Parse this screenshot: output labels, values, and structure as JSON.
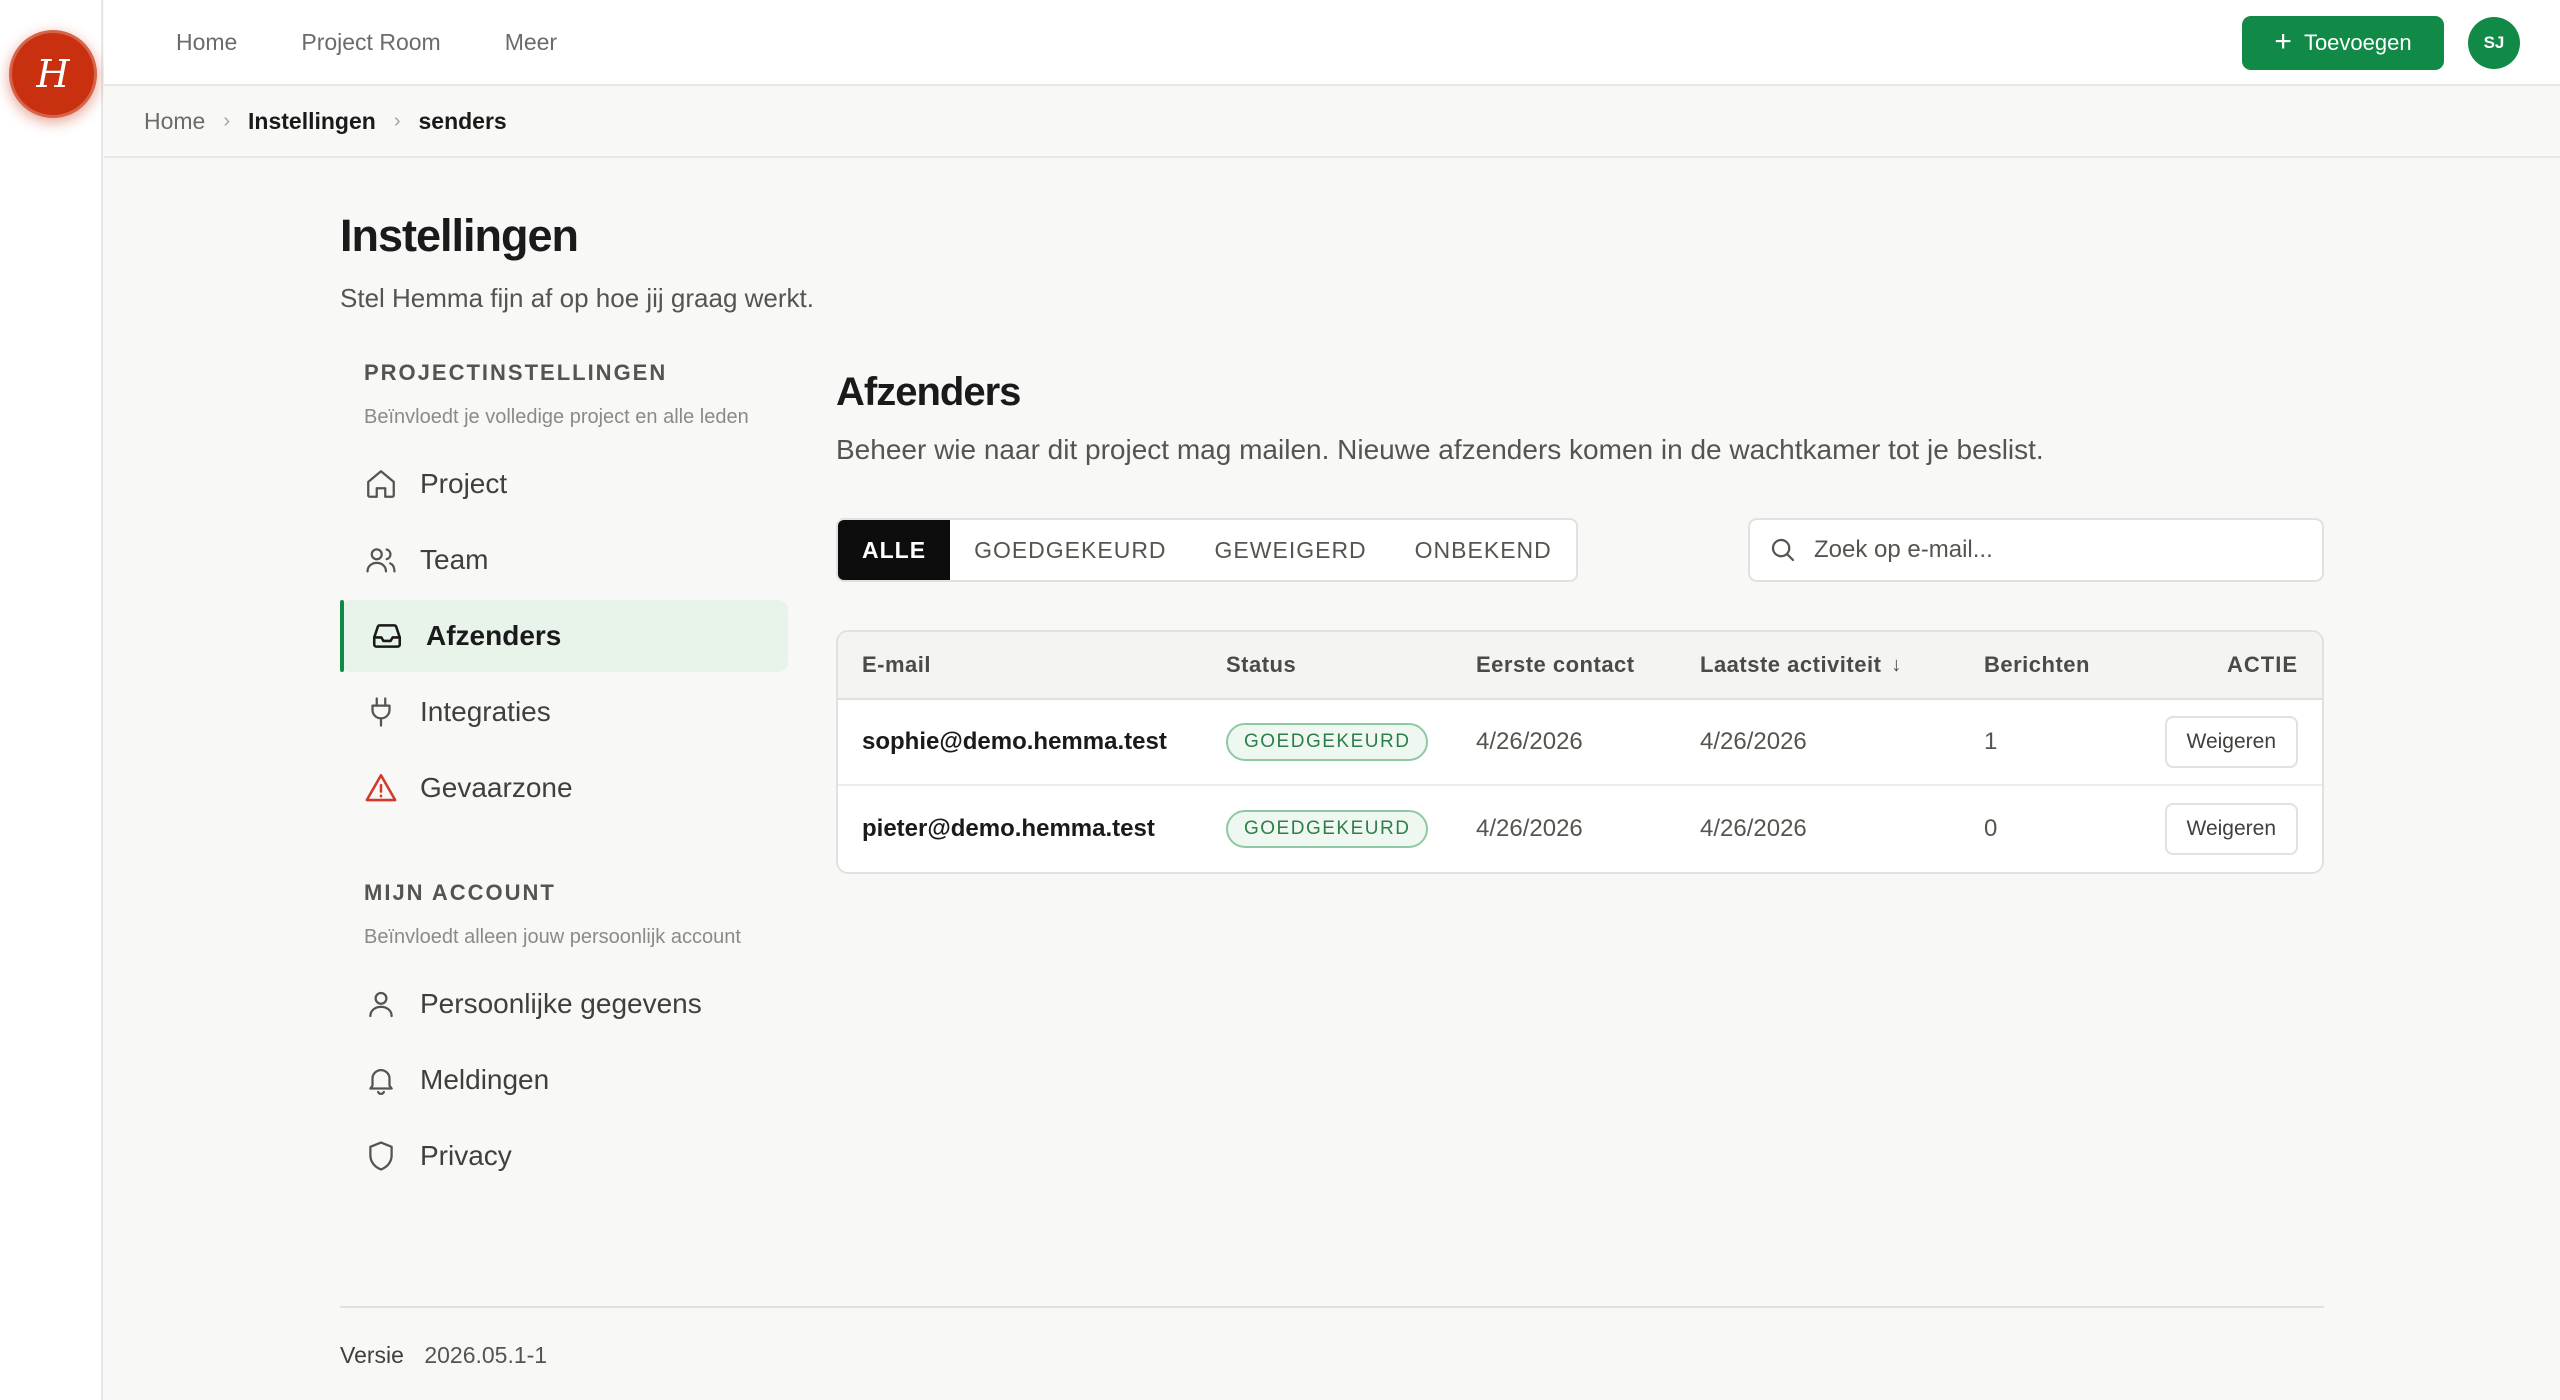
{
  "app": {
    "logo_letter": "H"
  },
  "topbar": {
    "nav": [
      "Home",
      "Project Room",
      "Meer"
    ],
    "add_button": "Toevoegen",
    "avatar_initials": "SJ",
    "accent_color": "#128a47"
  },
  "breadcrumb": {
    "items": [
      "Home",
      "Instellingen",
      "senders"
    ]
  },
  "page": {
    "title": "Instellingen",
    "subtitle": "Stel Hemma fijn af op hoe jij graag werkt."
  },
  "sidebar": {
    "project_section": {
      "heading": "PROJECTINSTELLINGEN",
      "description": "Beïnvloedt je volledige project en alle leden",
      "items": [
        {
          "label": "Project",
          "icon": "home-icon"
        },
        {
          "label": "Team",
          "icon": "users-icon"
        },
        {
          "label": "Afzenders",
          "icon": "inbox-icon",
          "active": true
        },
        {
          "label": "Integraties",
          "icon": "plug-icon"
        },
        {
          "label": "Gevaarzone",
          "icon": "warning-icon"
        }
      ]
    },
    "account_section": {
      "heading": "MIJN ACCOUNT",
      "description": "Beïnvloedt alleen jouw persoonlijk account",
      "items": [
        {
          "label": "Persoonlijke gegevens",
          "icon": "user-icon"
        },
        {
          "label": "Meldingen",
          "icon": "bell-icon"
        },
        {
          "label": "Privacy",
          "icon": "shield-icon"
        }
      ]
    }
  },
  "main": {
    "title": "Afzenders",
    "subtitle": "Beheer wie naar dit project mag mailen. Nieuwe afzenders komen in de wachtkamer tot je beslist.",
    "filters": [
      "ALLE",
      "GOEDGEKEURD",
      "GEWEIGERD",
      "ONBEKEND"
    ],
    "active_filter": "ALLE",
    "search": {
      "placeholder": "Zoek op e-mail...",
      "value": ""
    },
    "table": {
      "columns": [
        "E-mail",
        "Status",
        "Eerste contact",
        "Laatste activiteit",
        "Berichten",
        "ACTIE"
      ],
      "sort_indicator": "↓",
      "rows": [
        {
          "email": "sophie@demo.hemma.test",
          "status": "GOEDGEKEURD",
          "first_contact": "4/26/2026",
          "last_activity": "4/26/2026",
          "messages": "1",
          "action": "Weigeren"
        },
        {
          "email": "pieter@demo.hemma.test",
          "status": "GOEDGEKEURD",
          "first_contact": "4/26/2026",
          "last_activity": "4/26/2026",
          "messages": "0",
          "action": "Weigeren"
        }
      ]
    }
  },
  "footer": {
    "version_label": "Versie",
    "version_value": "2026.05.1-1"
  }
}
